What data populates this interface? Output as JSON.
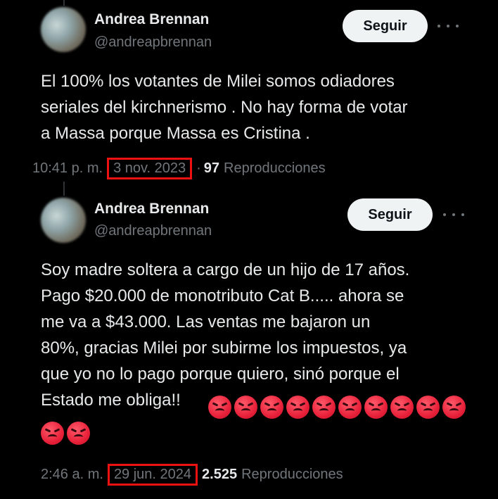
{
  "tweet1": {
    "name": "Andrea Brennan",
    "handle": "@andreapbrennan",
    "follow_label": "Seguir",
    "lines": [
      "El 100% los votantes de Milei somos odiadores",
      "seriales del kirchnerismo . No hay forma de votar",
      "a Massa porque Massa es Cristina ."
    ],
    "time": "10:41 p. m.",
    "date": "3 nov. 2023",
    "views_count": "97",
    "views_label": "Reproducciones"
  },
  "tweet2": {
    "name": "Andrea Brennan",
    "handle": "@andreapbrennan",
    "follow_label": "Seguir",
    "lines": [
      "Soy madre soltera a cargo de un hijo de 17 años.",
      "Pago $20.000 de monotributo Cat B..... ahora se",
      "me va a $43.000. Las ventas me bajaron un",
      "80%, gracias Milei por subirme los impuestos, ya",
      "que yo no lo pago porque quiero, sinó porque el",
      "Estado me obliga!!"
    ],
    "emoji_icon": "angry-face-icon",
    "emoji_count": 12,
    "time": "2:46 a. m.",
    "date": "29 jun. 2024",
    "views_count": "2.525",
    "views_label": "Reproducciones"
  },
  "colors": {
    "background": "#000000",
    "text": "#e7e9ea",
    "muted": "#71767b",
    "button_bg": "#eff3f4",
    "highlight_box": "#e11111"
  }
}
